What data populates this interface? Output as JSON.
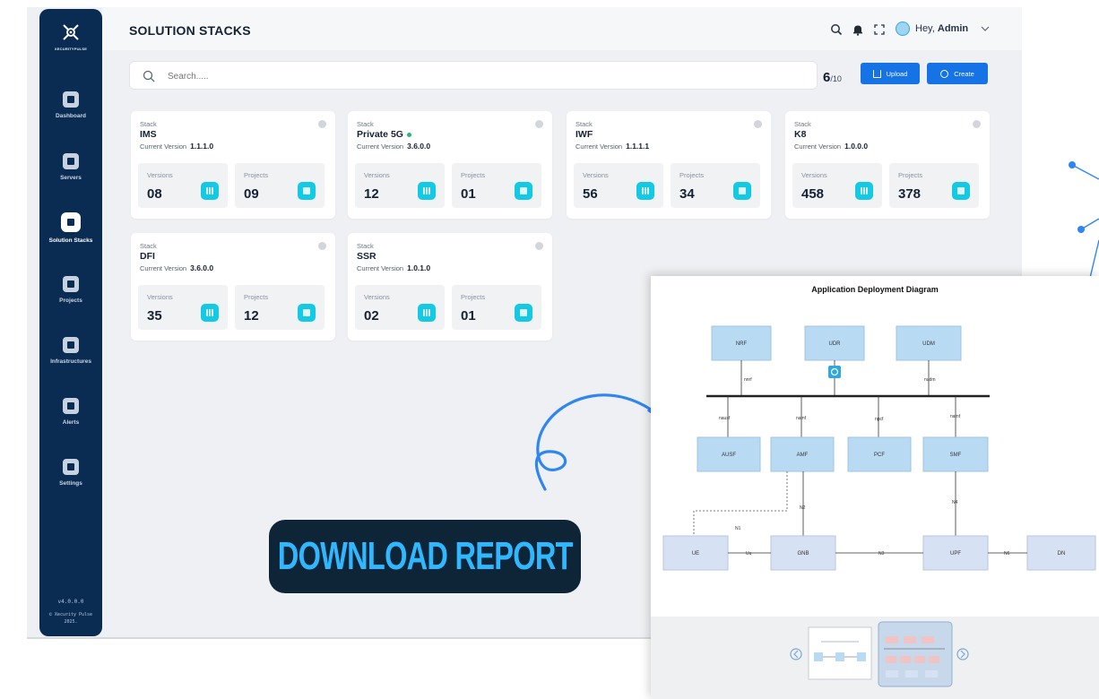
{
  "sidebar": {
    "brand": "XECURITYPULSE",
    "items": [
      {
        "label": "Dashboard",
        "icon": "dashboard-icon",
        "active": false
      },
      {
        "label": "Servers",
        "icon": "server-icon",
        "active": false
      },
      {
        "label": "Solution Stacks",
        "icon": "stack-icon",
        "active": true
      },
      {
        "label": "Projects",
        "icon": "projects-icon",
        "active": false
      },
      {
        "label": "Infrastructures",
        "icon": "infrastructure-icon",
        "active": false
      },
      {
        "label": "Alerts",
        "icon": "bell-icon",
        "active": false
      },
      {
        "label": "Settings",
        "icon": "settings-icon",
        "active": false
      }
    ],
    "version": "v4.0.0.0",
    "copyright_line1": "© Xecurity Pulse",
    "copyright_line2": "2025."
  },
  "header": {
    "title": "SOLUTION STACKS",
    "greeting": "Hey,",
    "user": "Admin",
    "icons": [
      "search-icon",
      "bell-icon",
      "fullscreen-icon",
      "chevron-down-icon"
    ]
  },
  "toolbar": {
    "search_placeholder": "Search.....",
    "count_current": "6",
    "count_total": "/10",
    "upload_label": "Upload",
    "create_label": "Create"
  },
  "stacks": [
    {
      "label": "Stack",
      "name": "IMS",
      "status_dot": false,
      "version_label": "Current Version",
      "version": "1.1.1.0",
      "versions_label": "Versions",
      "versions": "08",
      "projects_label": "Projects",
      "projects": "09"
    },
    {
      "label": "Stack",
      "name": "Private 5G",
      "status_dot": true,
      "version_label": "Current Version",
      "version": "3.6.0.0",
      "versions_label": "Versions",
      "versions": "12",
      "projects_label": "Projects",
      "projects": "01"
    },
    {
      "label": "Stack",
      "name": "IWF",
      "status_dot": false,
      "version_label": "Current Version",
      "version": "1.1.1.1",
      "versions_label": "Versions",
      "versions": "56",
      "projects_label": "Projects",
      "projects": "34"
    },
    {
      "label": "Stack",
      "name": "K8",
      "status_dot": false,
      "version_label": "Current Version",
      "version": "1.0.0.0",
      "versions_label": "Versions",
      "versions": "458",
      "projects_label": "Projects",
      "projects": "378"
    },
    {
      "label": "Stack",
      "name": "DFI",
      "status_dot": false,
      "version_label": "Current Version",
      "version": "3.6.0.0",
      "versions_label": "Versions",
      "versions": "35",
      "projects_label": "Projects",
      "projects": "12"
    },
    {
      "label": "Stack",
      "name": "SSR",
      "status_dot": false,
      "version_label": "Current Version",
      "version": "1.0.1.0",
      "versions_label": "Versions",
      "versions": "02",
      "projects_label": "Projects",
      "projects": "01"
    }
  ],
  "download": {
    "label": "DOWNLOAD REPORT"
  },
  "diagram": {
    "title": "Application Deployment Diagram",
    "nodes": {
      "nrf": "NRF",
      "udr": "UDR",
      "udm": "UDM",
      "ausf": "AUSF",
      "amf": "AMF",
      "pcf": "PCF",
      "smf": "SMF",
      "ue": "UE",
      "gnb": "GNB",
      "upf": "UPF",
      "dn": "DN"
    },
    "links": {
      "nnrf": "nnrf",
      "nudm": "nudm",
      "nausf": "nausf",
      "namf": "namf",
      "npcf": "npcf",
      "nsmf": "namf",
      "n1": "N1",
      "n2": "N2",
      "n4": "N4",
      "uu": "Uu",
      "n3": "N3",
      "n6": "N6"
    }
  },
  "colors": {
    "sidebar": "#0b2c52",
    "accent": "#1673e6",
    "tile": "#14c9e3",
    "download_bg": "#0e2437",
    "download_text": "#2fb8ff",
    "node_fill": "#b9daf3"
  }
}
